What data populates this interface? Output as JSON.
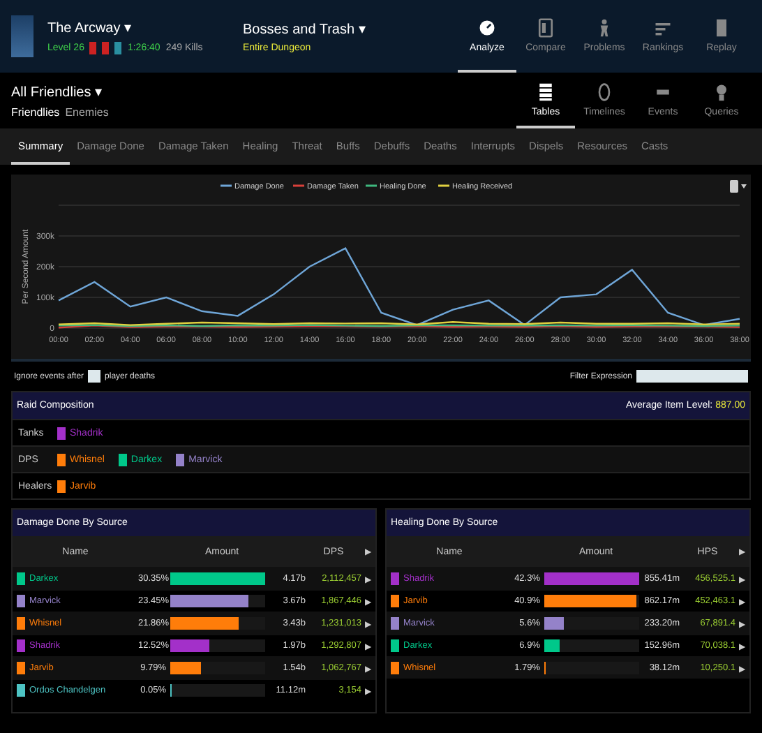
{
  "header": {
    "zone": "The Arcway ▾",
    "level": "Level 26",
    "duration": "1:26:40",
    "kills": "249 Kills",
    "fight": "Bosses and Trash ▾",
    "fight_sub": "Entire Dungeon",
    "nav": [
      {
        "label": "Analyze",
        "selected": true
      },
      {
        "label": "Compare",
        "selected": false
      },
      {
        "label": "Problems",
        "selected": false
      },
      {
        "label": "Rankings",
        "selected": false
      },
      {
        "label": "Replay",
        "selected": false
      }
    ]
  },
  "filter": {
    "title": "All Friendlies ▾",
    "friendlies": "Friendlies",
    "enemies": "Enemies",
    "views": [
      {
        "label": "Tables",
        "selected": true
      },
      {
        "label": "Timelines",
        "selected": false
      },
      {
        "label": "Events",
        "selected": false
      },
      {
        "label": "Queries",
        "selected": false
      }
    ]
  },
  "tabs": [
    {
      "label": "Summary",
      "selected": true
    },
    {
      "label": "Damage Done",
      "selected": false
    },
    {
      "label": "Damage Taken",
      "selected": false
    },
    {
      "label": "Healing",
      "selected": false
    },
    {
      "label": "Threat",
      "selected": false
    },
    {
      "label": "Buffs",
      "selected": false
    },
    {
      "label": "Debuffs",
      "selected": false
    },
    {
      "label": "Deaths",
      "selected": false
    },
    {
      "label": "Interrupts",
      "selected": false
    },
    {
      "label": "Dispels",
      "selected": false
    },
    {
      "label": "Resources",
      "selected": false
    },
    {
      "label": "Casts",
      "selected": false
    }
  ],
  "chart": {
    "chart_data": {
      "type": "line",
      "ylabel": "Per Second Amount",
      "grid": true,
      "legend": true,
      "ylim": [
        0,
        400
      ],
      "x": [
        "00:00",
        "02:00",
        "04:00",
        "06:00",
        "08:00",
        "10:00",
        "12:00",
        "14:00",
        "16:00",
        "18:00",
        "20:00",
        "22:00",
        "24:00",
        "26:00",
        "28:00",
        "30:00",
        "32:00",
        "34:00",
        "36:00",
        "38:00"
      ],
      "yticks": [
        {
          "value": 0,
          "label": "0"
        },
        {
          "value": 100,
          "label": "100k"
        },
        {
          "value": 200,
          "label": "200k"
        },
        {
          "value": 300,
          "label": "300k"
        }
      ],
      "series": [
        {
          "name": "Damage Done",
          "color": "#6fa6d8",
          "values": [
            90,
            150,
            70,
            100,
            55,
            40,
            110,
            200,
            260,
            50,
            10,
            60,
            90,
            10,
            100,
            110,
            190,
            50,
            10,
            30
          ]
        },
        {
          "name": "Damage Taken",
          "color": "#d9403a",
          "values": [
            2,
            8,
            3,
            5,
            5,
            4,
            5,
            6,
            6,
            5,
            6,
            4,
            5,
            4,
            6,
            4,
            5,
            5,
            5,
            3
          ]
        },
        {
          "name": "Healing Done",
          "color": "#3fb87f",
          "values": [
            8,
            10,
            7,
            9,
            7,
            9,
            8,
            10,
            8,
            7,
            9,
            9,
            8,
            8,
            9,
            8,
            9,
            8,
            7,
            8
          ]
        },
        {
          "name": "Healing Received",
          "color": "#e0d040",
          "values": [
            12,
            16,
            10,
            14,
            18,
            16,
            13,
            16,
            15,
            16,
            12,
            20,
            14,
            13,
            18,
            14,
            14,
            16,
            12,
            14
          ]
        }
      ]
    }
  },
  "options": {
    "ignore_before": "Ignore events after",
    "ignore_after": "player deaths",
    "filter_label": "Filter Expression"
  },
  "raid": {
    "title": "Raid Composition",
    "ilvl_label": "Average Item Level:",
    "ilvl": "887.00",
    "roles": [
      {
        "role": "Tanks",
        "players": [
          {
            "name": "Shadrik",
            "color": "#a330c9"
          }
        ]
      },
      {
        "role": "DPS",
        "players": [
          {
            "name": "Whisnel",
            "color": "#ff7d0a"
          },
          {
            "name": "Darkex",
            "color": "#00c88a"
          },
          {
            "name": "Marvick",
            "color": "#9482c9"
          }
        ]
      },
      {
        "role": "Healers",
        "players": [
          {
            "name": "Jarvib",
            "color": "#ff7d0a"
          }
        ]
      }
    ]
  },
  "tables": [
    {
      "title": "Damage Done By Source",
      "columns": [
        "Name",
        "Amount",
        "DPS"
      ],
      "header_arrow": "▶",
      "rows": [
        {
          "name": "Darkex",
          "color": "#00c88a",
          "pct": "30.35%",
          "level": 1,
          "amount": "4.17b",
          "rate": "2,112,457",
          "arrow": "▶"
        },
        {
          "name": "Marvick",
          "color": "#9482c9",
          "pct": "23.45%",
          "level": 0.82,
          "amount": "3.67b",
          "rate": "1,867,446",
          "arrow": "▶"
        },
        {
          "name": "Whisnel",
          "color": "#ff7d0a",
          "pct": "21.86%",
          "level": 0.72,
          "amount": "3.43b",
          "rate": "1,231,013",
          "arrow": "▶"
        },
        {
          "name": "Shadrik",
          "color": "#a330c9",
          "pct": "12.52%",
          "level": 0.41,
          "amount": "1.97b",
          "rate": "1,292,807",
          "arrow": "▶"
        },
        {
          "name": "Jarvib",
          "color": "#ff7d0a",
          "pct": "9.79%",
          "level": 0.32,
          "amount": "1.54b",
          "rate": "1,062,767",
          "arrow": "▶"
        },
        {
          "name": "Ordos Chandelgen",
          "color": "#4dc3c3",
          "pct": "0.05%",
          "level": 0.005,
          "amount": "11.12m",
          "rate": "3,154",
          "arrow": "▶"
        }
      ]
    },
    {
      "title": "Healing Done By Source",
      "columns": [
        "Name",
        "Amount",
        "HPS"
      ],
      "header_arrow": "▶",
      "rows": [
        {
          "name": "Shadrik",
          "color": "#a330c9",
          "pct": "42.3%",
          "level": 1,
          "amount": "855.41m",
          "rate": "456,525.1",
          "arrow": "▶"
        },
        {
          "name": "Jarvib",
          "color": "#ff7d0a",
          "pct": "40.9%",
          "level": 0.97,
          "amount": "862.17m",
          "rate": "452,463.1",
          "arrow": "▶"
        },
        {
          "name": "Marvick",
          "color": "#9482c9",
          "pct": "5.6%",
          "level": 0.2,
          "amount": "233.20m",
          "rate": "67,891.4",
          "arrow": "▶"
        },
        {
          "name": "Darkex",
          "color": "#00c88a",
          "pct": "6.9%",
          "level": 0.16,
          "amount": "152.96m",
          "rate": "70,038.1",
          "arrow": "▶"
        },
        {
          "name": "Whisnel",
          "color": "#ff7d0a",
          "pct": "1.79%",
          "level": 0.02,
          "amount": "38.12m",
          "rate": "10,250.1",
          "arrow": "▶"
        }
      ]
    }
  ]
}
